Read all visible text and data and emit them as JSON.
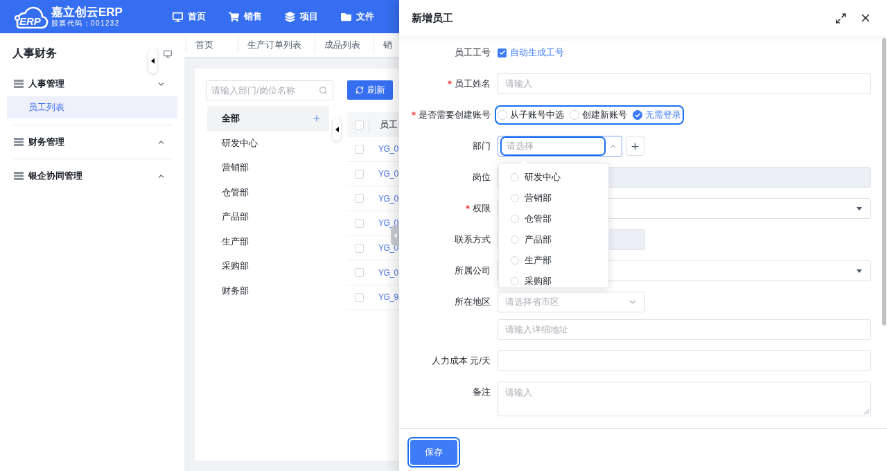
{
  "header": {
    "logo_mark": "ERP",
    "logo_title": "嘉立创云ERP",
    "logo_subtitle": "股票代码：001232",
    "nav": [
      {
        "label": "首页"
      },
      {
        "label": "销售"
      },
      {
        "label": "项目"
      },
      {
        "label": "文件"
      }
    ]
  },
  "sidebar": {
    "title": "人事财务",
    "groups": [
      {
        "label": "人事管理",
        "expanded": true,
        "children": [
          {
            "label": "员工列表",
            "selected": true
          }
        ]
      },
      {
        "label": "财务管理",
        "expanded": false
      },
      {
        "label": "银企协同管理",
        "expanded": false
      }
    ]
  },
  "page_tabs": [
    {
      "label": "首页"
    },
    {
      "label": "生产订单列表"
    },
    {
      "label": "成品列表"
    },
    {
      "label": "销"
    }
  ],
  "department_panel": {
    "search": {
      "placeholder": "请输入部门/岗位名称"
    },
    "departments": [
      {
        "label": "全部",
        "selected": true
      },
      {
        "label": "研发中心",
        "selected": false
      },
      {
        "label": "营销部",
        "selected": false
      },
      {
        "label": "仓管部",
        "selected": false
      },
      {
        "label": "产品部",
        "selected": false
      },
      {
        "label": "生产部",
        "selected": false
      },
      {
        "label": "采购部",
        "selected": false
      },
      {
        "label": "财务部",
        "selected": false
      }
    ]
  },
  "employee_table": {
    "refresh_button": "刷新",
    "select_all_checked": false,
    "columns": [
      {
        "label": "员工"
      }
    ],
    "rows": [
      {
        "checked": false,
        "cells": [
          "YG_0"
        ]
      },
      {
        "checked": false,
        "cells": [
          "YG_0"
        ]
      },
      {
        "checked": false,
        "cells": [
          "YG_0"
        ]
      },
      {
        "checked": false,
        "cells": [
          "YG_0"
        ]
      },
      {
        "checked": false,
        "cells": [
          "YG_0"
        ]
      },
      {
        "checked": false,
        "cells": [
          "YG_0"
        ]
      },
      {
        "checked": false,
        "cells": [
          "YG_9"
        ]
      }
    ]
  },
  "drawer": {
    "title": "新增员工",
    "fields": [
      {
        "kind": "checkbox",
        "label": "员工工号",
        "required": false,
        "option": {
          "label": "自动生成工号",
          "checked": true
        }
      },
      {
        "kind": "text",
        "label": "员工姓名",
        "required": true,
        "disabled": false,
        "placeholder": "请输入"
      },
      {
        "kind": "radio",
        "label": "是否需要创建账号",
        "required": true,
        "focused": true,
        "options": [
          {
            "label": "从子账号中选",
            "selected": false
          },
          {
            "label": "创建新账号",
            "selected": false
          },
          {
            "label": "无需登录",
            "selected": true
          }
        ]
      },
      {
        "kind": "select",
        "label": "部门",
        "required": false,
        "focused": true,
        "expanded": true,
        "placeholder": "请选择",
        "options": [
          {
            "label": "研发中心",
            "selected": false
          },
          {
            "label": "营销部",
            "selected": false
          },
          {
            "label": "仓管部",
            "selected": false
          },
          {
            "label": "产品部",
            "selected": false
          },
          {
            "label": "生产部",
            "selected": false
          },
          {
            "label": "采购部",
            "selected": false
          }
        ]
      },
      {
        "kind": "text",
        "label": "岗位",
        "required": false,
        "disabled": true
      },
      {
        "kind": "dropdown",
        "label": "权限",
        "required": true
      },
      {
        "kind": "short_text",
        "label": "联系方式",
        "required": false,
        "disabled": true
      },
      {
        "kind": "dropdown",
        "label": "所属公司",
        "required": false
      },
      {
        "kind": "region",
        "label": "所在地区",
        "required": false,
        "placeholder": "请选择省市区",
        "address": {
          "placeholder": "请输入详细地址"
        }
      },
      {
        "kind": "text",
        "label": "人力成本 元/天",
        "required": false,
        "disabled": false
      },
      {
        "kind": "textarea",
        "label": "备注",
        "required": false,
        "placeholder": "请输入"
      }
    ],
    "save_button": {
      "label": "保存",
      "focused": true
    }
  }
}
